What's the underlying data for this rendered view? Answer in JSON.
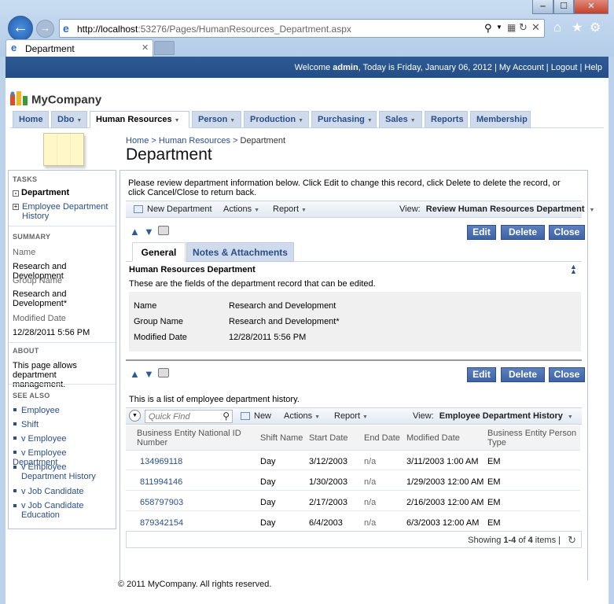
{
  "browser": {
    "url": "http://localhost:53276/Pages/HumanResources_Department.aspx",
    "url_host": "http://localhost",
    "url_rest": ":53276/Pages/HumanResources_Department.aspx",
    "tab_title": "Department"
  },
  "topbar": {
    "welcome": "Welcome",
    "user": "admin",
    "today": ", Today is Friday, January 06, 2012",
    "my_account": "My Account",
    "logout": "Logout",
    "help": "Help"
  },
  "logo": "MyCompany",
  "menu": [
    {
      "label": "Home",
      "dropdown": false
    },
    {
      "label": "Dbo",
      "dropdown": true
    },
    {
      "label": "Human Resources",
      "dropdown": true,
      "active": true
    },
    {
      "label": "Person",
      "dropdown": true
    },
    {
      "label": "Production",
      "dropdown": true
    },
    {
      "label": "Purchasing",
      "dropdown": true
    },
    {
      "label": "Sales",
      "dropdown": true
    },
    {
      "label": "Reports",
      "dropdown": false
    },
    {
      "label": "Membership",
      "dropdown": false
    }
  ],
  "breadcrumb": {
    "home": "Home",
    "section": "Human Resources",
    "current": "Department"
  },
  "page_title": "Department",
  "sidebar": {
    "tasks_header": "TASKS",
    "task_current": "Department",
    "task_link": "Employee Department History",
    "summary_header": "SUMMARY",
    "name_label": "Name",
    "name_value": "Research and Development",
    "group_label": "Group Name",
    "group_value": "Research and Development*",
    "modified_label": "Modified Date",
    "modified_value": "12/28/2011 5:56 PM",
    "about_header": "ABOUT",
    "about_text": "This page allows department management.",
    "see_also_header": "SEE ALSO",
    "see_also": [
      "Employee",
      "Shift",
      "v Employee",
      "v Employee Department",
      "v Employee Department History",
      "v Job Candidate",
      "v Job Candidate Education"
    ]
  },
  "form": {
    "intro": "Please review department information below. Click Edit to change this record, click Delete to delete the record, or click Cancel/Close to return back.",
    "toolbar": {
      "new": "New Department",
      "actions": "Actions",
      "report": "Report",
      "view_label": "View:",
      "view_value": "Review Human Resources Department"
    },
    "buttons": {
      "edit": "Edit",
      "delete": "Delete",
      "close": "Close"
    },
    "tabs": {
      "general": "General",
      "notes": "Notes & Attachments"
    },
    "section_title": "Human Resources Department",
    "section_desc": "These are the fields of the department record that can be edited.",
    "fields": [
      {
        "label": "Name",
        "value": "Research and Development"
      },
      {
        "label": "Group Name",
        "value": "Research and Development*"
      },
      {
        "label": "Modified Date",
        "value": "12/28/2011 5:56 PM"
      }
    ]
  },
  "history": {
    "intro": "This is a list of employee department history.",
    "toolbar": {
      "quick_find": "Quick Find",
      "new": "New",
      "actions": "Actions",
      "report": "Report",
      "view_label": "View:",
      "view_value": "Employee Department History"
    },
    "columns": [
      "Business Entity National ID Number",
      "Shift Name",
      "Start Date",
      "End Date",
      "Modified Date",
      "Business Entity Person Type"
    ],
    "rows": [
      [
        "134969118",
        "Day",
        "3/12/2003",
        "n/a",
        "3/11/2003 1:00 AM",
        "EM"
      ],
      [
        "811994146",
        "Day",
        "1/30/2003",
        "n/a",
        "1/29/2003 12:00 AM",
        "EM"
      ],
      [
        "658797903",
        "Day",
        "2/17/2003",
        "n/a",
        "2/16/2003 12:00 AM",
        "EM"
      ],
      [
        "879342154",
        "Day",
        "6/4/2003",
        "n/a",
        "6/3/2003 12:00 AM",
        "EM"
      ]
    ],
    "pager_prefix": "Showing ",
    "pager_range": "1-4",
    "pager_of": " of ",
    "pager_total": "4",
    "pager_suffix": " items"
  },
  "footer": "© 2011 MyCompany. All rights reserved.",
  "colors": {
    "topbar": "#2f5b95",
    "menu": "#cfdbec",
    "button": "#3e63a6",
    "link": "#2a4f86"
  }
}
